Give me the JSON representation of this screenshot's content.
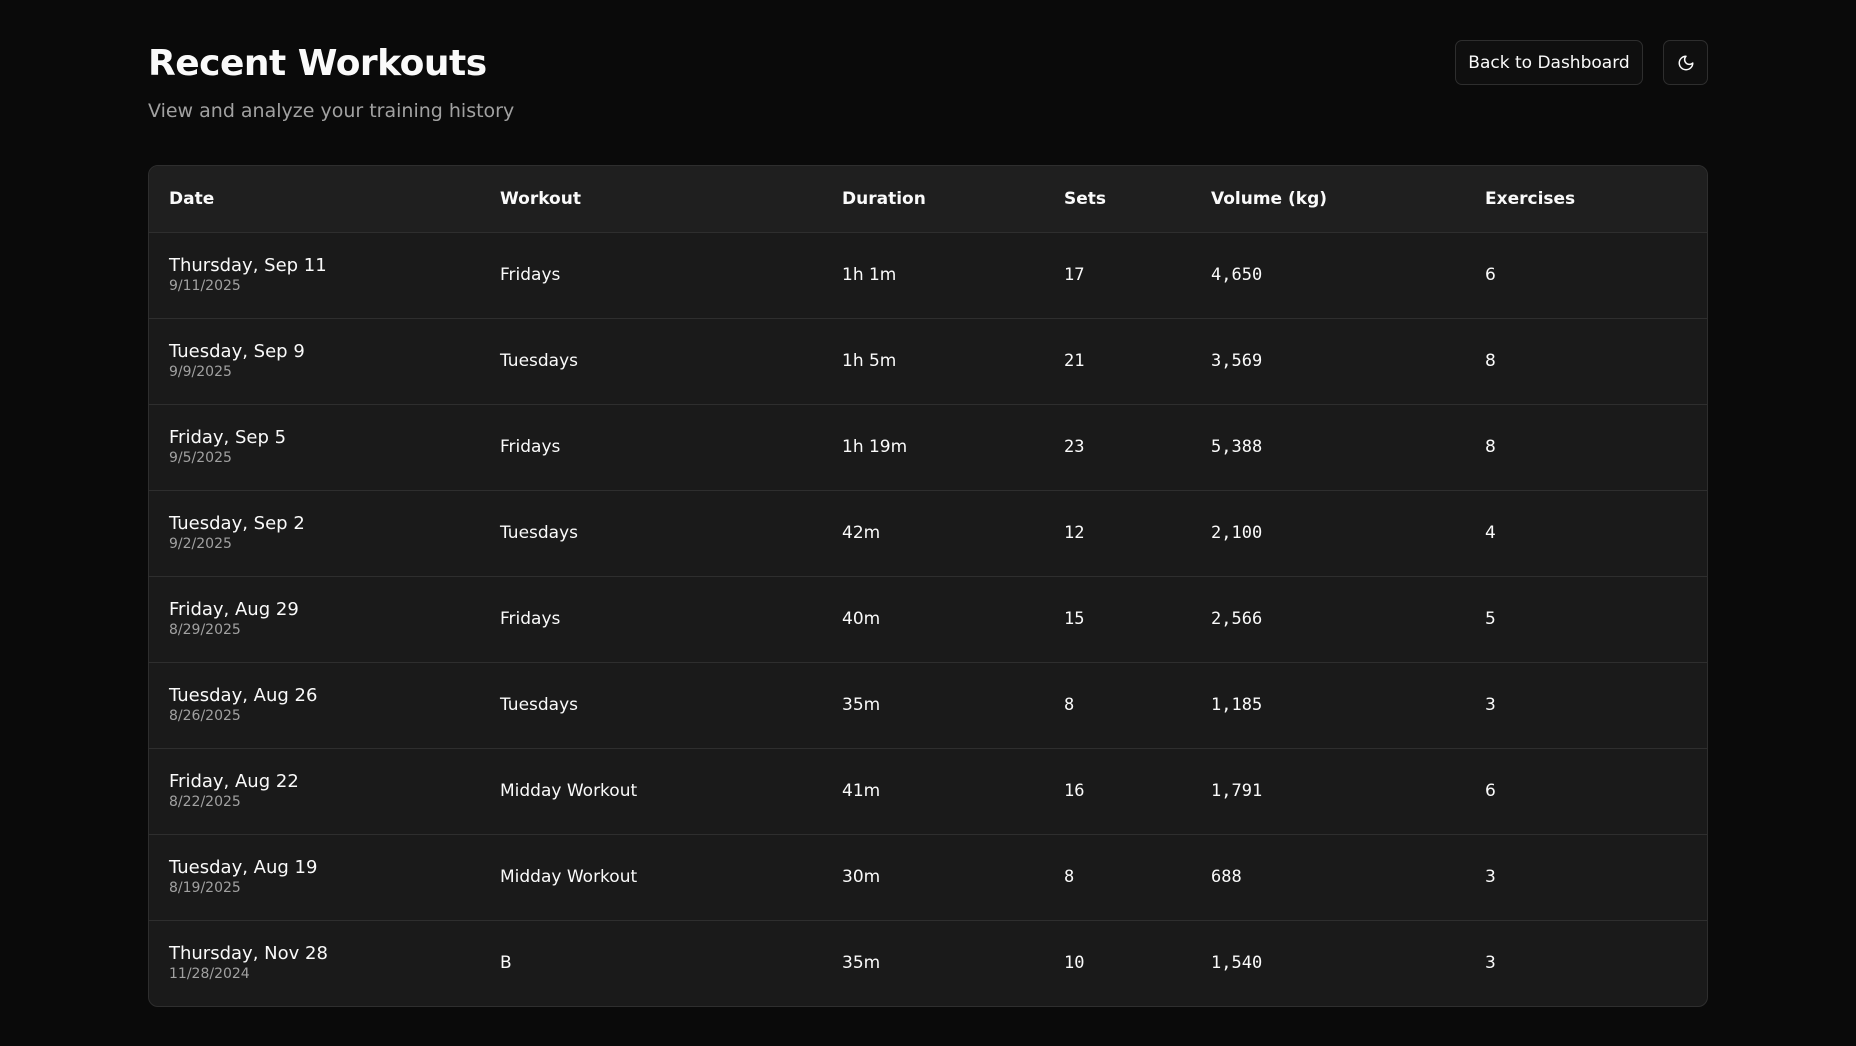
{
  "header": {
    "title": "Recent Workouts",
    "subtitle": "View and analyze your training history",
    "back_button_label": "Back to Dashboard",
    "theme_toggle_icon": "moon-icon"
  },
  "table": {
    "columns": [
      "Date",
      "Workout",
      "Duration",
      "Sets",
      "Volume (kg)",
      "Exercises"
    ],
    "rows": [
      {
        "date": "Thursday, Sep 11",
        "date_short": "9/11/2025",
        "workout": "Fridays",
        "duration": "1h 1m",
        "sets": "17",
        "volume": "4,650",
        "exercises": "6"
      },
      {
        "date": "Tuesday, Sep 9",
        "date_short": "9/9/2025",
        "workout": "Tuesdays",
        "duration": "1h 5m",
        "sets": "21",
        "volume": "3,569",
        "exercises": "8"
      },
      {
        "date": "Friday, Sep 5",
        "date_short": "9/5/2025",
        "workout": "Fridays",
        "duration": "1h 19m",
        "sets": "23",
        "volume": "5,388",
        "exercises": "8"
      },
      {
        "date": "Tuesday, Sep 2",
        "date_short": "9/2/2025",
        "workout": "Tuesdays",
        "duration": "42m",
        "sets": "12",
        "volume": "2,100",
        "exercises": "4"
      },
      {
        "date": "Friday, Aug 29",
        "date_short": "8/29/2025",
        "workout": "Fridays",
        "duration": "40m",
        "sets": "15",
        "volume": "2,566",
        "exercises": "5"
      },
      {
        "date": "Tuesday, Aug 26",
        "date_short": "8/26/2025",
        "workout": "Tuesdays",
        "duration": "35m",
        "sets": "8",
        "volume": "1,185",
        "exercises": "3"
      },
      {
        "date": "Friday, Aug 22",
        "date_short": "8/22/2025",
        "workout": "Midday Workout",
        "duration": "41m",
        "sets": "16",
        "volume": "1,791",
        "exercises": "6"
      },
      {
        "date": "Tuesday, Aug 19",
        "date_short": "8/19/2025",
        "workout": "Midday Workout",
        "duration": "30m",
        "sets": "8",
        "volume": "688",
        "exercises": "3"
      },
      {
        "date": "Thursday, Nov 28",
        "date_short": "11/28/2024",
        "workout": "B",
        "duration": "35m",
        "sets": "10",
        "volume": "1,540",
        "exercises": "3"
      }
    ]
  },
  "colors": {
    "background": "#0a0a0a",
    "card": "#1a1a1a",
    "border": "#2e2e2e",
    "text": "#fafafa",
    "muted": "#a1a1a1"
  }
}
